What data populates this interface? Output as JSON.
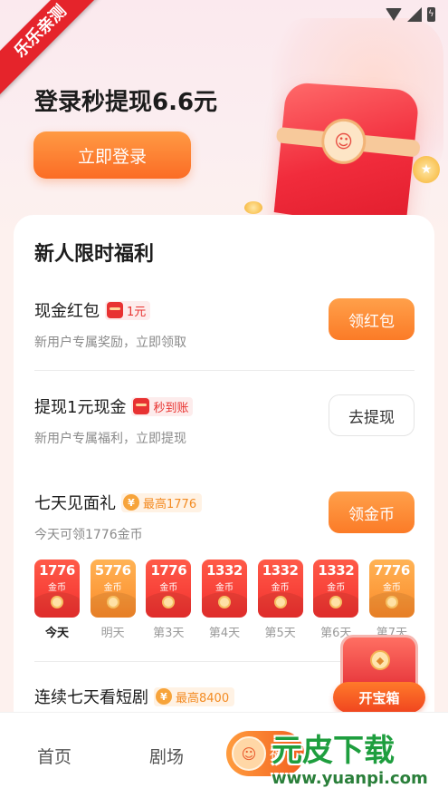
{
  "status_bar": {
    "icons": [
      "wifi-icon",
      "signal-icon",
      "battery-icon"
    ]
  },
  "ribbon": {
    "label": "乐乐亲测"
  },
  "hero": {
    "title": "登录秒提现6.6元",
    "login_button": "立即登录"
  },
  "card": {
    "title": "新人限时福利",
    "tasks": [
      {
        "name": "现金红包",
        "badge": "1元",
        "desc": "新用户专属奖励，立即领取",
        "button": "领红包"
      },
      {
        "name": "提现1元现金",
        "badge": "秒到账",
        "desc": "新用户专属福利，立即提现",
        "button": "去提现"
      },
      {
        "name": "七天见面礼",
        "badge": "最高1776",
        "desc": "今天可领1776金币",
        "button": "领金币"
      },
      {
        "name": "连续七天看短剧",
        "badge": "最高8400"
      }
    ],
    "days": [
      {
        "amount": "1776",
        "unit": "金币",
        "label": "今天",
        "style": "red"
      },
      {
        "amount": "5776",
        "unit": "金币",
        "label": "明天",
        "style": "gold"
      },
      {
        "amount": "1776",
        "unit": "金币",
        "label": "第3天",
        "style": "red"
      },
      {
        "amount": "1332",
        "unit": "金币",
        "label": "第4天",
        "style": "red"
      },
      {
        "amount": "1332",
        "unit": "金币",
        "label": "第5天",
        "style": "red"
      },
      {
        "amount": "1332",
        "unit": "金币",
        "label": "第6天",
        "style": "red"
      },
      {
        "amount": "7776",
        "unit": "金币",
        "label": "第7天",
        "style": "gold"
      }
    ]
  },
  "treasure": {
    "button": "开宝箱"
  },
  "tabbar": {
    "home": "首页",
    "theater": "剧场",
    "center_label": "福"
  },
  "watermark": {
    "text": "元皮下载",
    "url": "www.yuanpi.com"
  },
  "colors": {
    "accent_orange": "#fb7b27",
    "accent_red": "#e8322f",
    "gold": "#f7a43b"
  }
}
